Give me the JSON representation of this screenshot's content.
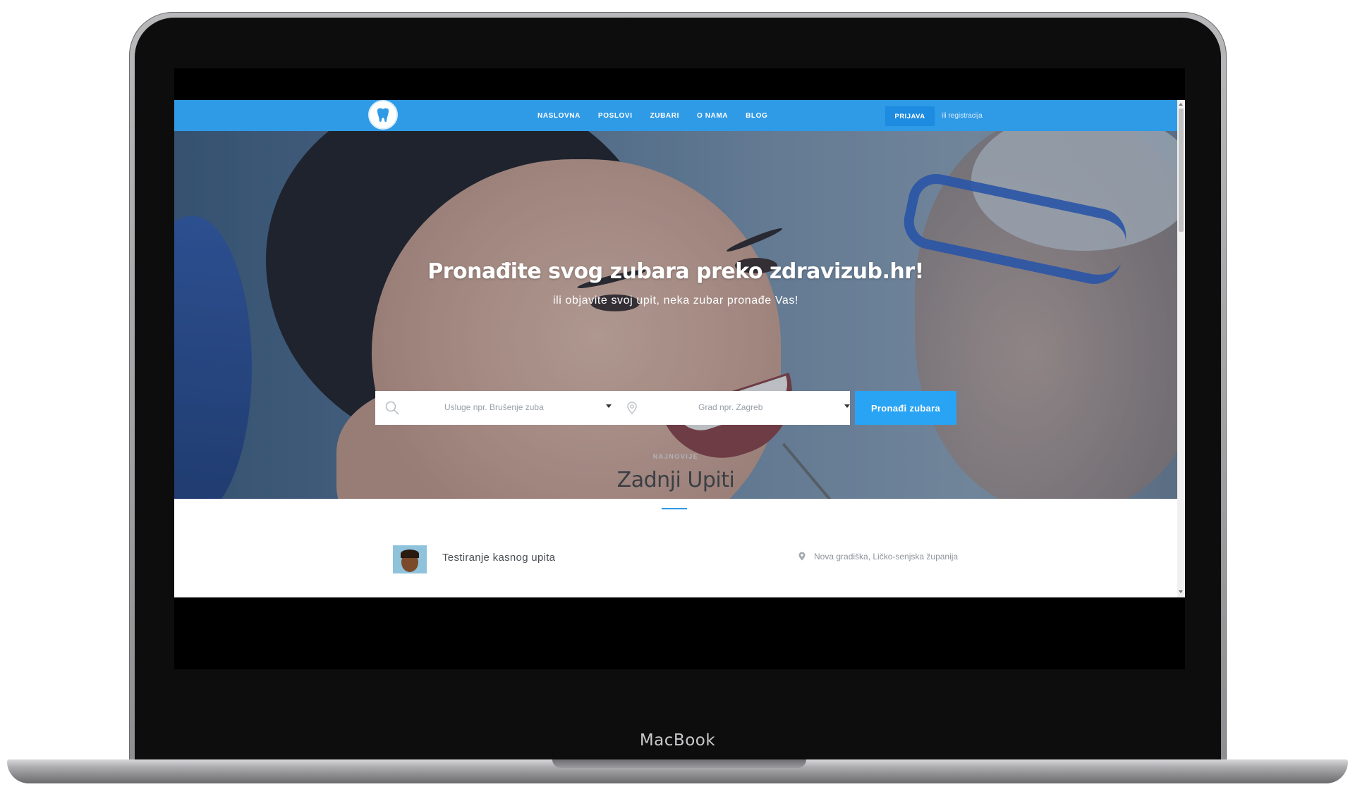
{
  "device": {
    "label": "MacBook"
  },
  "nav": {
    "items": [
      "NASLOVNA",
      "POSLOVI",
      "ZUBARI",
      "O NAMA",
      "BLOG"
    ],
    "login_label": "PRIJAVA",
    "register_label": "ili registracija",
    "accent_color": "#2f9ae6"
  },
  "hero": {
    "title": "Pronađite svog zubara preko zdravizub.hr!",
    "subtitle": "ili objavite svoj upit, neka zubar pronađe Vas!",
    "service_placeholder": "Usluge npr. Brušenje zuba",
    "city_placeholder": "Grad npr. Zagreb",
    "search_button": "Pronađi zubara",
    "search_icon": "search-icon",
    "location_icon": "map-pin-icon",
    "button_color": "#29a4f4"
  },
  "latest": {
    "eyebrow": "NAJNOVIJE",
    "title": "Zadnji Upiti",
    "items": [
      {
        "title": "Testiranje kasnog upita",
        "location": "Nova gradiška, Ličko-senjska županija"
      }
    ]
  }
}
